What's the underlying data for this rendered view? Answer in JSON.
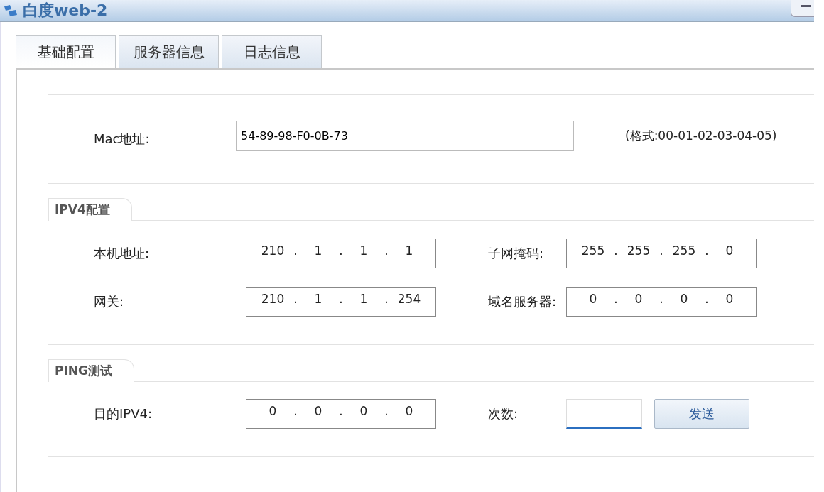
{
  "window": {
    "title": "白度web-2"
  },
  "tabs": [
    {
      "label": "基础配置",
      "selected": true
    },
    {
      "label": "服务器信息",
      "selected": false
    },
    {
      "label": "日志信息",
      "selected": false
    }
  ],
  "mac": {
    "label": "Mac地址:",
    "value": "54-89-98-F0-0B-73",
    "hint": "(格式:00-01-02-03-04-05)"
  },
  "ipv4": {
    "title": "IPV4配置",
    "fields": [
      {
        "label": "本机地址:",
        "parts": [
          "210",
          ".",
          "1",
          ".",
          "1",
          ".",
          "1"
        ]
      },
      {
        "label": "子网掩码:",
        "parts": [
          "255",
          ".",
          "255",
          ".",
          "255",
          ".",
          "0"
        ]
      },
      {
        "label": "网关:",
        "parts": [
          "210",
          ".",
          "1",
          ".",
          "1",
          ".",
          "254"
        ]
      },
      {
        "label": "域名服务器:",
        "parts": [
          "0",
          ".",
          "0",
          ".",
          "0",
          ".",
          "0"
        ]
      }
    ]
  },
  "ping": {
    "title": "PING测试",
    "target": {
      "label": "目的IPV4:",
      "parts": [
        "0",
        ".",
        "0",
        ".",
        "0",
        ".",
        "0"
      ]
    },
    "count": {
      "label": "次数:",
      "focused": true
    },
    "button": "发送"
  }
}
